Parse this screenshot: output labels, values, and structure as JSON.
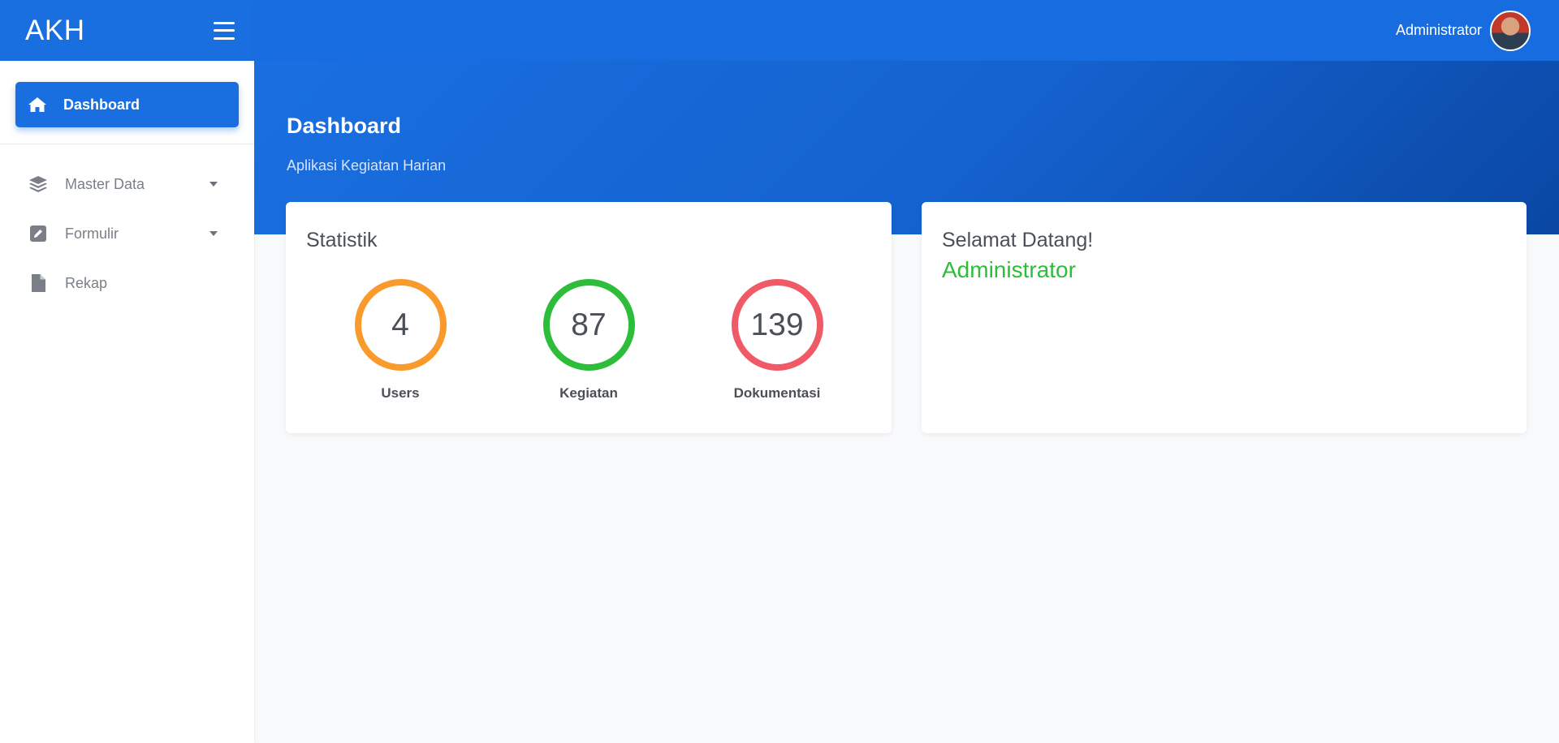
{
  "brand": {
    "title": "AKH"
  },
  "topbar": {
    "user_name": "Administrator"
  },
  "sidebar": {
    "items": [
      {
        "label": "Dashboard",
        "icon": "home-icon",
        "active": true
      },
      {
        "label": "Master Data",
        "icon": "layers-icon",
        "has_submenu": true
      },
      {
        "label": "Formulir",
        "icon": "edit-icon",
        "has_submenu": true
      },
      {
        "label": "Rekap",
        "icon": "file-icon"
      }
    ]
  },
  "header": {
    "title": "Dashboard",
    "subtitle": "Aplikasi Kegiatan Harian"
  },
  "stats_card": {
    "title": "Statistik",
    "items": [
      {
        "value": "4",
        "label": "Users",
        "color": "#f89a2c"
      },
      {
        "value": "87",
        "label": "Kegiatan",
        "color": "#2ebd3a"
      },
      {
        "value": "139",
        "label": "Dokumentasi",
        "color": "#ef5a66"
      }
    ]
  },
  "welcome_card": {
    "greeting": "Selamat Datang!",
    "name": "Administrator"
  },
  "colors": {
    "primary": "#1a6fe0",
    "success": "#2ebd3a"
  }
}
